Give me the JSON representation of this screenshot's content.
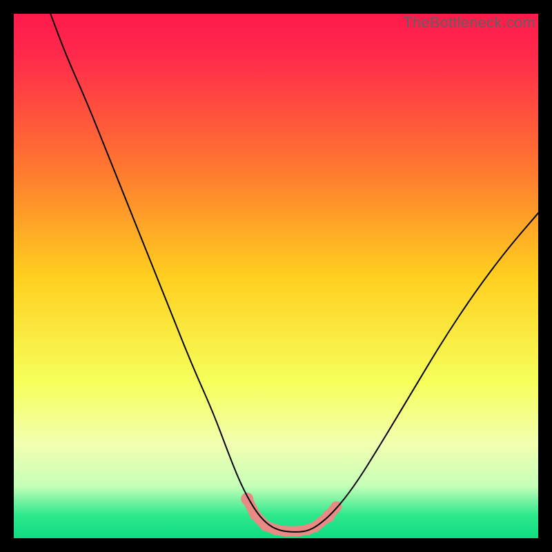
{
  "watermark": {
    "text": "TheBottleneck.com"
  },
  "chart_data": {
    "type": "line",
    "title": "",
    "xlabel": "",
    "ylabel": "",
    "xlim": [
      0,
      100
    ],
    "ylim": [
      0,
      100
    ],
    "background_gradient": {
      "stops": [
        {
          "offset": 0.0,
          "color": "#ff1a4b"
        },
        {
          "offset": 0.08,
          "color": "#ff2a4b"
        },
        {
          "offset": 0.3,
          "color": "#ff7a2f"
        },
        {
          "offset": 0.5,
          "color": "#ffcf1f"
        },
        {
          "offset": 0.7,
          "color": "#f6ff5a"
        },
        {
          "offset": 0.82,
          "color": "#f2ffb0"
        },
        {
          "offset": 0.9,
          "color": "#c6ffb8"
        },
        {
          "offset": 0.955,
          "color": "#30e88c"
        },
        {
          "offset": 1.0,
          "color": "#0edc82"
        }
      ]
    },
    "series": [
      {
        "name": "curve",
        "color": "#000000",
        "width": 2.0,
        "x": [
          7,
          10,
          14,
          18,
          22,
          26,
          30,
          34,
          38,
          41,
          43,
          45,
          47,
          49,
          51,
          53,
          54.5,
          56,
          58,
          61,
          65,
          70,
          76,
          82,
          88,
          94,
          100
        ],
        "y": [
          100,
          92,
          83,
          73,
          63,
          53,
          43,
          33,
          24,
          16,
          11,
          7,
          4,
          2.2,
          1.4,
          1.2,
          1.2,
          1.4,
          2.4,
          5,
          10,
          18,
          28,
          38,
          47,
          55,
          62
        ]
      }
    ],
    "markers": {
      "name": "highlight-band",
      "color": "#e98a84",
      "points": [
        {
          "x": 44.5,
          "y": 7.5,
          "r": 9
        },
        {
          "x": 46.0,
          "y": 4.5,
          "r": 8
        },
        {
          "x": 48.0,
          "y": 2.4,
          "r": 8
        },
        {
          "x": 50.0,
          "y": 1.6,
          "r": 8
        },
        {
          "x": 52.0,
          "y": 1.3,
          "r": 8
        },
        {
          "x": 54.0,
          "y": 1.3,
          "r": 8
        },
        {
          "x": 56.0,
          "y": 1.6,
          "r": 8
        },
        {
          "x": 57.5,
          "y": 2.2,
          "r": 8
        },
        {
          "x": 60.0,
          "y": 4.2,
          "r": 9
        },
        {
          "x": 61.5,
          "y": 6.0,
          "r": 8
        }
      ]
    }
  }
}
